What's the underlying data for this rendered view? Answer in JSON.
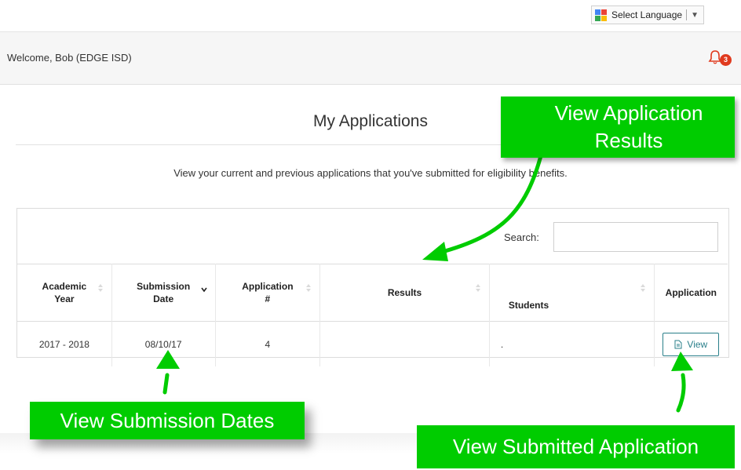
{
  "language_selector": {
    "label": "Select Language",
    "arrow": "▼",
    "icon": "google-translate-icon"
  },
  "header": {
    "welcome": "Welcome, Bob (EDGE ISD)",
    "notification_count": "3",
    "notification_icon": "bell-icon"
  },
  "page": {
    "title": "My Applications",
    "subtitle": "View your current and previous applications that you've submitted for eligibility benefits."
  },
  "table": {
    "search_label": "Search:",
    "columns": [
      {
        "label": "Academic Year",
        "sort": "unsorted"
      },
      {
        "label": "Submission Date",
        "sort": "descending"
      },
      {
        "label": "Application #",
        "sort": "unsorted"
      },
      {
        "label": "Results",
        "sort": "unsorted"
      },
      {
        "label": "Students",
        "sort": "unsorted"
      },
      {
        "label": "Application",
        "sort": "none"
      }
    ],
    "rows": [
      {
        "academic_year": "2017 - 2018",
        "submission_date": "08/10/17",
        "application_number": "4",
        "results": "",
        "students": ".",
        "view_label": "View"
      }
    ]
  },
  "callouts": {
    "results": "View Application Results",
    "dates": "View Submission Dates",
    "application": "View Submitted Application"
  },
  "colors": {
    "callout_green": "#00cc00",
    "accent_teal": "#2a7f8a",
    "badge_red": "#e03a1e"
  }
}
